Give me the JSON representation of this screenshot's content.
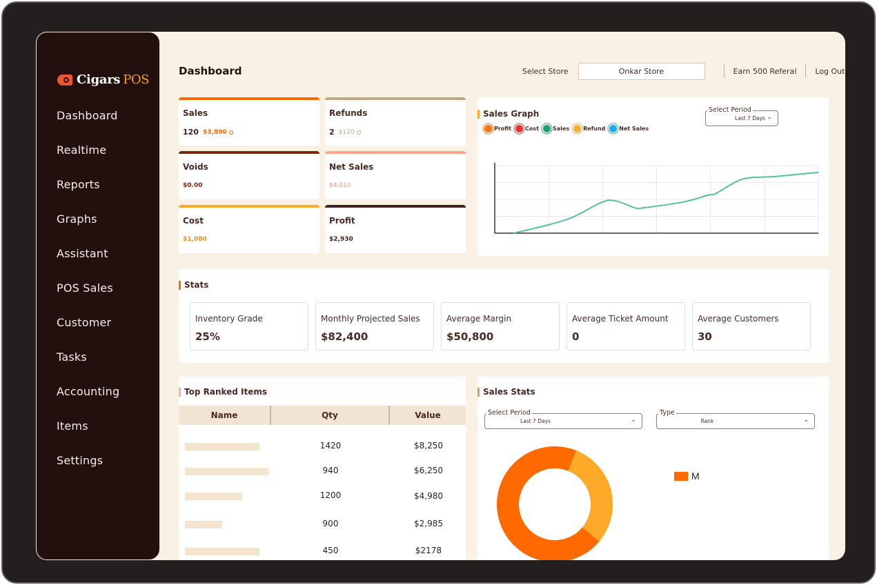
{
  "brand": {
    "name": "Cigars",
    "accent": "POS"
  },
  "sidebar": {
    "items": [
      {
        "label": "Dashboard"
      },
      {
        "label": "Realtime"
      },
      {
        "label": "Reports"
      },
      {
        "label": "Graphs"
      },
      {
        "label": "Assistant"
      },
      {
        "label": "POS Sales"
      },
      {
        "label": "Customer"
      },
      {
        "label": "Tasks"
      },
      {
        "label": "Accounting"
      },
      {
        "label": "Items"
      },
      {
        "label": "Settings"
      }
    ]
  },
  "header": {
    "title": "Dashboard",
    "store_label": "Select Store",
    "store_value": "Onkar Store",
    "referral_link": "Earn 500 Referal",
    "logout_link": "Log Out"
  },
  "kpis": [
    {
      "title": "Sales",
      "count": "120",
      "amount": "$3,890",
      "color": "#ff6a00",
      "amount_color": "#ff6a00",
      "icon": "up-circle-icon"
    },
    {
      "title": "Refunds",
      "count": "2",
      "amount": "$120",
      "color": "#c1a683",
      "amount_color": "#c1a683",
      "icon": "down-circle-icon"
    },
    {
      "title": "Voids",
      "amount": "$0.00",
      "color": "#7a2a10",
      "amount_color": "#7a2a10"
    },
    {
      "title": "Net Sales",
      "amount": "$4,010",
      "color": "#ffa48a",
      "amount_color": "#f6937a"
    },
    {
      "title": "Cost",
      "amount": "$1,080",
      "color": "#ffa929",
      "amount_color": "#e0932a"
    },
    {
      "title": "Profit",
      "amount": "$2,930",
      "color": "#3e231f",
      "amount_color": "#3a2520"
    }
  ],
  "sales_graph": {
    "title": "Sales Graph",
    "period_label": "Select Period",
    "period_value": "Last 7 Days",
    "legend": [
      {
        "label": "Profit",
        "color": "#ff6a00"
      },
      {
        "label": "Cost",
        "color": "#ef2727"
      },
      {
        "label": "Sales",
        "color": "#13a06c"
      },
      {
        "label": "Refund",
        "color": "#ffa929"
      },
      {
        "label": "Net Sales",
        "color": "#12a7e8"
      }
    ]
  },
  "chart_data": [
    {
      "type": "line",
      "title": "Sales Graph",
      "xlabel": "",
      "ylabel": "",
      "grid": true,
      "x_ticks": 6,
      "y_ticks": 4,
      "ylim": [
        0,
        4
      ],
      "xlim": [
        0,
        6
      ],
      "series": [
        {
          "name": "Sales",
          "color": "#4fc497",
          "points": [
            [
              0.35,
              0
            ],
            [
              1.0,
              0.5
            ],
            [
              1.45,
              0.95
            ],
            [
              2.0,
              1.85
            ],
            [
              2.25,
              1.9
            ],
            [
              2.6,
              1.5
            ],
            [
              2.75,
              1.5
            ],
            [
              3.5,
              1.85
            ],
            [
              3.95,
              2.25
            ],
            [
              4.1,
              2.35
            ],
            [
              4.6,
              3.2
            ],
            [
              5.2,
              3.35
            ],
            [
              6.0,
              3.6
            ]
          ]
        }
      ]
    },
    {
      "type": "pie",
      "title": "Sales Stats",
      "donut": true,
      "slices": [
        {
          "label": "M",
          "value": 70,
          "color": "#ff6a00"
        },
        {
          "label": "",
          "value": 30,
          "color": "#ffa929"
        }
      ],
      "legend": [
        "M"
      ],
      "legend_position": "right"
    }
  ],
  "stats": {
    "title": "Stats",
    "items": [
      {
        "label": "Inventory Grade",
        "value": "25%"
      },
      {
        "label": "Monthly Projected Sales",
        "value": "$82,400"
      },
      {
        "label": "Average Margin",
        "value": "$50,800"
      },
      {
        "label": "Average Ticket Amount",
        "value": "0"
      },
      {
        "label": "Average Customers",
        "value": "30"
      }
    ]
  },
  "top_items": {
    "title": "Top Ranked Items",
    "columns": [
      "Name",
      "Qty",
      "Value"
    ],
    "rows": [
      {
        "name_fill": 0.26,
        "qty": "1420",
        "value": "$8,250"
      },
      {
        "name_fill": 0.29,
        "qty": "940",
        "value": "$6,250"
      },
      {
        "name_fill": 0.2,
        "qty": "1200",
        "value": "$4,980"
      },
      {
        "name_fill": 0.13,
        "qty": "900",
        "value": "$2,985"
      },
      {
        "name_fill": 0.26,
        "qty": "450",
        "value": "$2178"
      }
    ]
  },
  "sales_stats": {
    "title": "Sales Stats",
    "period_label": "Select Period",
    "period_value": "Last 7 Days",
    "type_label": "Type",
    "type_value": "Rank",
    "legend_label": "M"
  }
}
